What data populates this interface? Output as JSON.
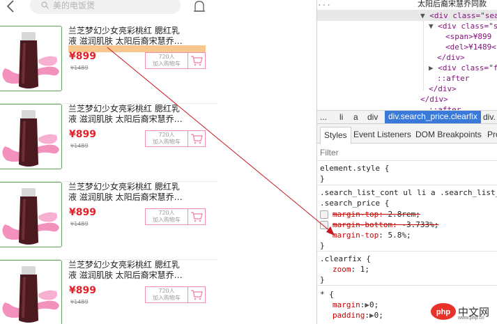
{
  "mobile": {
    "search_placeholder": "美的电饭煲",
    "products": [
      {
        "title_line1": "兰芝梦幻少女亮彩桃红  腮红乳",
        "title_line2": "液  滋润肌肤  太阳后裔宋慧乔…",
        "price": "¥899",
        "old_price": "¥1489",
        "cart_count": "720人",
        "cart_label": "加入购物车"
      },
      {
        "title_line1": "兰芝梦幻少女亮彩桃红  腮红乳",
        "title_line2": "液  滋润肌肤  太阳后裔宋慧乔…",
        "price": "¥899",
        "old_price": "¥1489",
        "cart_count": "720人",
        "cart_label": "加入购物车"
      },
      {
        "title_line1": "兰芝梦幻少女亮彩桃红  腮红乳",
        "title_line2": "液  滋润肌肤  太阳后裔宋慧乔…",
        "price": "¥899",
        "old_price": "¥1489",
        "cart_count": "720人",
        "cart_label": "加入购物车"
      },
      {
        "title_line1": "兰芝梦幻少女亮彩桃红  腮红乳",
        "title_line2": "液  滋润肌肤  太阳后裔宋慧乔…",
        "price": "¥899",
        "old_price": "¥1489",
        "cart_count": "720人",
        "cart_label": "加入购物车"
      }
    ]
  },
  "devtools": {
    "elements": {
      "top_text": "太阳后裔宋慧乔同款",
      "line1_tag": "<div class=\"search_price clearfix\">",
      "line1_vis": "<div class=\"sear",
      "line2_vis": "<div class=\"se",
      "line3_vis": "<span>¥899",
      "line4_vis": "<del>¥1489<",
      "line5_vis": "</div>",
      "line6_vis": "<div class=\"fr",
      "line7_vis": "::after",
      "line8_vis": "</div>",
      "line9_vis": "</div>",
      "line10_vis": "::after"
    },
    "breadcrumb": {
      "ellipsis": "...",
      "li": "li",
      "a": "a",
      "div": "div",
      "active": "div.search_price.clearfix",
      "next": "div."
    },
    "tabs": {
      "styles": "Styles",
      "listeners": "Event Listeners",
      "dom": "DOM Breakpoints",
      "props": "Pro"
    },
    "filter_placeholder": "Filter",
    "styles": {
      "element_style": "element.style {",
      "close": "}",
      "selector_line1": ".search_list_cont ul li a .search_list_",
      "selector_line2": ".search_price {",
      "prop1": "margin-top",
      "val1": "2.8rem;",
      "prop2": "margin-bottom",
      "val2": "-3.733%;",
      "prop3": "margin-top",
      "val3": "5.8%;",
      "clearfix": ".clearfix {",
      "zoom_prop": "zoom",
      "zoom_val": "1;",
      "universal": "* {",
      "margin_prop": "margin",
      "margin_val": "0;",
      "padding_prop": "padding",
      "padding_val": "0;"
    },
    "watermark": {
      "text": "中文网",
      "site": "www.php.cn"
    }
  },
  "colors": {
    "price": "#e0222c",
    "cart_border": "#f08fb0",
    "highlight": "#f8c78f",
    "annotation_line": "#c8141e",
    "breadcrumb_active": "#3879d9"
  }
}
